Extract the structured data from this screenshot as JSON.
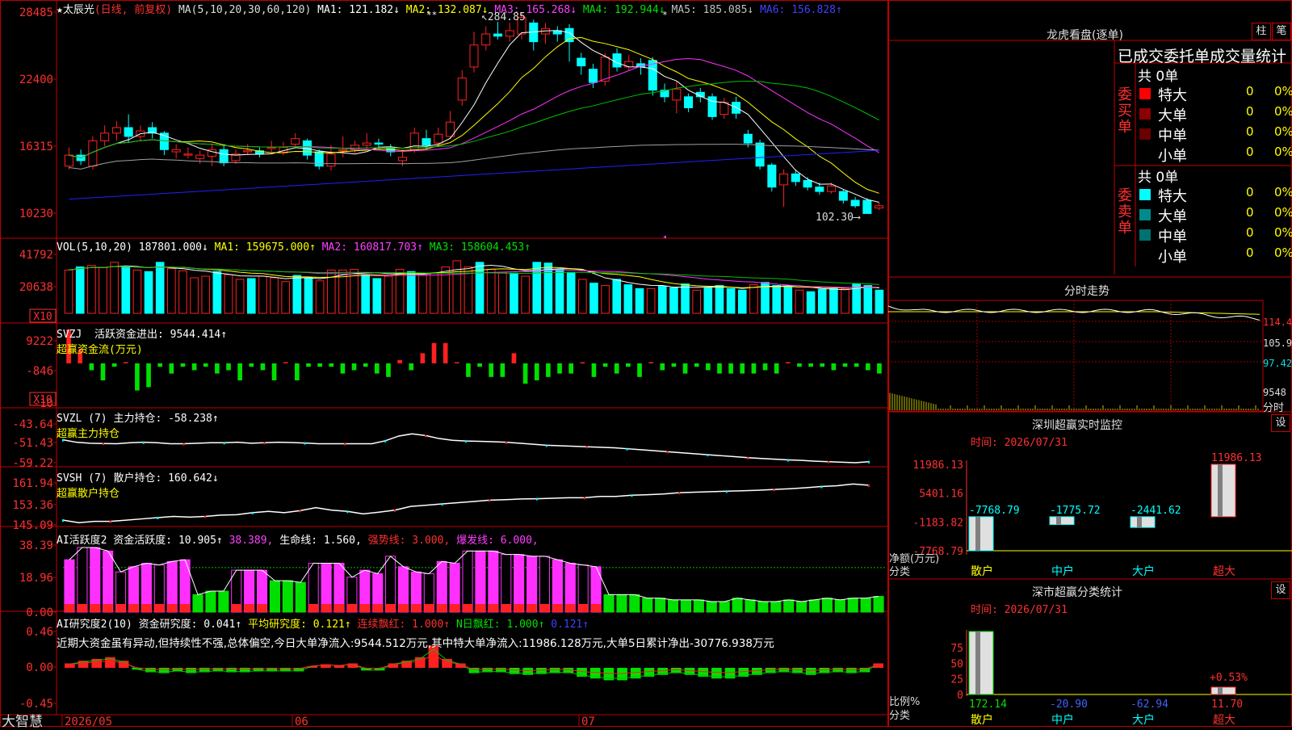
{
  "stock": {
    "name_label": "★太辰光",
    "mode_label": "(日线, 前复权)",
    "ma_header": "MA(5,10,20,30,60,120)",
    "ma1": "MA1: 121.182↓",
    "ma2": "MA2: 132.087↓",
    "ma3": "MA3: 165.268↓",
    "ma4": "MA4: 192.944↓",
    "ma5": "MA5: 185.085↓",
    "ma6": "MA6: 156.828↑",
    "high_note": "284.85",
    "low_note": "102.30"
  },
  "axes": {
    "price": [
      "28485",
      "22400",
      "16315",
      "10230"
    ],
    "vol": [
      "41792",
      "20638"
    ],
    "svzj": [
      "9222",
      "-846",
      "-10"
    ],
    "svzl": [
      "-43.64",
      "-51.43",
      "-59.22"
    ],
    "svsh": [
      "161.94",
      "153.36",
      "145.09"
    ],
    "ai1": [
      "38.39",
      "18.96",
      "0.00"
    ],
    "ai2": [
      "0.46",
      "0.00",
      "-0.45"
    ],
    "x10": "X10",
    "dates": [
      "2026/05",
      "06",
      "07"
    ]
  },
  "vol_header": {
    "a": "VOL(5,10,20) 187801.000↓",
    "b": "MA1: 159675.000↑",
    "c": "MA2: 160817.703↑",
    "d": "MA3: 158604.453↑"
  },
  "svzj_header": {
    "a": "SVZJ  活跃资金进出: 9544.414↑",
    "b": "超赢资金流(万元)"
  },
  "svzl_header": {
    "a": "SVZL (7) 主力持仓: -58.238↑",
    "b": "超赢主力持仓"
  },
  "svsh_header": {
    "a": "SVSH (7) 散户持仓: 160.642↓",
    "b": "超赢散户持仓"
  },
  "ai1_header": {
    "a": "AI活跃度2 资金活跃度: 10.905↑",
    "b": "38.389,",
    "c": "生命线: 1.560,",
    "d": "强势线: 3.000,",
    "e": "爆发线: 6.000,"
  },
  "ai2_header": {
    "a": "AI研究度2(10) 资金研究度: 0.041↑",
    "b": "平均研究度: 0.121↑",
    "c": "连续飘红: 1.000↑",
    "d": "N日飘红: 1.000↑",
    "e": "0.121↑",
    "comment": "近期大资金虽有异动,但持续性不强,总体偏空,今日大单净流入:9544.512万元,其中特大单净流入:11986.128万元,大单5日累计净出-30776.938万元"
  },
  "footer": {
    "brand": "大智慧"
  },
  "right": {
    "lhkp_title": "龙虎看盘(逐单)",
    "btn_zhu": "柱",
    "btn_bi": "笔",
    "section_title": "已成交委托单成交量统计",
    "buy_label": "委买单",
    "sell_label": "委卖单",
    "buy_total": "共 0单",
    "sell_total": "共 0单",
    "buy_rows": [
      {
        "name": "特大",
        "count": "0",
        "pct": "0%",
        "color": "#ff0000"
      },
      {
        "name": "大单",
        "count": "0",
        "pct": "0%",
        "color": "#8b0000"
      },
      {
        "name": "中单",
        "count": "0",
        "pct": "0%",
        "color": "#6b0000"
      },
      {
        "name": "小单",
        "count": "0",
        "pct": "0%",
        "color": "#000000"
      }
    ],
    "sell_rows": [
      {
        "name": "特大",
        "count": "0",
        "pct": "0%",
        "color": "#00ffff"
      },
      {
        "name": "大单",
        "count": "0",
        "pct": "0%",
        "color": "#008b8b"
      },
      {
        "name": "中单",
        "count": "0",
        "pct": "0%",
        "color": "#007070"
      },
      {
        "name": "小单",
        "count": "0",
        "pct": "0%",
        "color": "#000000"
      }
    ],
    "fszs_title": "分时走势",
    "fszs_axis": [
      "114.4",
      "105.9",
      "97.42",
      "9548",
      "分时"
    ],
    "monitor_title": "深圳超赢实时监控",
    "monitor_time": "时间: 2026/07/31",
    "monitor_btn": "设",
    "monitor_axis": [
      "11986.13",
      "5401.16",
      "-1183.82",
      "-7768.79"
    ],
    "monitor_ylabel": "净额(万元)",
    "monitor_xlabel": "分类",
    "stat_title": "深市超赢分类统计",
    "stat_time": "时间: 2026/07/31",
    "stat_btn": "设",
    "stat_axis": [
      "75",
      "50",
      "25",
      "0"
    ],
    "stat_ylabel": "比例%",
    "stat_xlabel": "分类"
  },
  "chart_data": [
    {
      "type": "candlestick",
      "title": "太辰光 日线 前复权",
      "x_range": [
        "2026/05",
        "2026/07"
      ],
      "ylim": [
        10230,
        28485
      ],
      "candles": [
        {
          "o": 14500,
          "c": 15500,
          "h": 16200,
          "l": 14200
        },
        {
          "o": 15500,
          "c": 15000,
          "h": 16000,
          "l": 14600
        },
        {
          "o": 14500,
          "c": 16800,
          "h": 17200,
          "l": 14200
        },
        {
          "o": 16800,
          "c": 17500,
          "h": 18200,
          "l": 16300
        },
        {
          "o": 17500,
          "c": 18000,
          "h": 18600,
          "l": 16800
        },
        {
          "o": 18000,
          "c": 17200,
          "h": 19200,
          "l": 16600
        },
        {
          "o": 17200,
          "c": 17700,
          "h": 18200,
          "l": 16800
        },
        {
          "o": 18000,
          "c": 17500,
          "h": 18500,
          "l": 17000
        },
        {
          "o": 17500,
          "c": 16000,
          "h": 17700,
          "l": 15500
        },
        {
          "o": 15800,
          "c": 16000,
          "h": 16500,
          "l": 15200
        },
        {
          "o": 15500,
          "c": 15600,
          "h": 16200,
          "l": 15200
        },
        {
          "o": 15200,
          "c": 15500,
          "h": 15900,
          "l": 14700
        },
        {
          "o": 15400,
          "c": 16000,
          "h": 16500,
          "l": 14500
        },
        {
          "o": 16000,
          "c": 14800,
          "h": 16500,
          "l": 14500
        },
        {
          "o": 15000,
          "c": 15600,
          "h": 16000,
          "l": 14700
        },
        {
          "o": 15800,
          "c": 15900,
          "h": 16500,
          "l": 15500
        },
        {
          "o": 15900,
          "c": 15600,
          "h": 16200,
          "l": 15300
        },
        {
          "o": 16100,
          "c": 16200,
          "h": 16800,
          "l": 15700
        },
        {
          "o": 15700,
          "c": 16200,
          "h": 16700,
          "l": 15500
        },
        {
          "o": 16500,
          "c": 17000,
          "h": 17500,
          "l": 16300
        },
        {
          "o": 16800,
          "c": 15500,
          "h": 17000,
          "l": 15100
        },
        {
          "o": 15800,
          "c": 14500,
          "h": 16000,
          "l": 14200
        },
        {
          "o": 14500,
          "c": 15600,
          "h": 16400,
          "l": 14100
        },
        {
          "o": 15900,
          "c": 16000,
          "h": 17200,
          "l": 15300
        },
        {
          "o": 16000,
          "c": 16400,
          "h": 16800,
          "l": 15700
        },
        {
          "o": 16400,
          "c": 16600,
          "h": 17500,
          "l": 16000
        },
        {
          "o": 16600,
          "c": 16500,
          "h": 17000,
          "l": 16100
        },
        {
          "o": 16100,
          "c": 15800,
          "h": 16500,
          "l": 15400
        },
        {
          "o": 15000,
          "c": 15300,
          "h": 16000,
          "l": 14500
        },
        {
          "o": 16000,
          "c": 17500,
          "h": 18000,
          "l": 15700
        },
        {
          "o": 17000,
          "c": 16400,
          "h": 17800,
          "l": 16000
        },
        {
          "o": 16600,
          "c": 17400,
          "h": 18000,
          "l": 16300
        },
        {
          "o": 17200,
          "c": 18500,
          "h": 19500,
          "l": 17000
        },
        {
          "o": 20500,
          "c": 22500,
          "h": 23200,
          "l": 20000
        },
        {
          "o": 23500,
          "c": 25500,
          "h": 26700,
          "l": 23000
        },
        {
          "o": 25500,
          "c": 26500,
          "h": 27200,
          "l": 25000
        },
        {
          "o": 26500,
          "c": 26300,
          "h": 27600,
          "l": 26000
        },
        {
          "o": 26300,
          "c": 26800,
          "h": 27500,
          "l": 25800
        },
        {
          "o": 26500,
          "c": 28000,
          "h": 28485,
          "l": 26000
        },
        {
          "o": 27500,
          "c": 25800,
          "h": 27800,
          "l": 25000
        },
        {
          "o": 26500,
          "c": 27000,
          "h": 27500,
          "l": 25600
        },
        {
          "o": 26800,
          "c": 26500,
          "h": 27200,
          "l": 25800
        },
        {
          "o": 27000,
          "c": 25800,
          "h": 27400,
          "l": 24000
        },
        {
          "o": 24300,
          "c": 23600,
          "h": 24800,
          "l": 22800
        },
        {
          "o": 23300,
          "c": 22100,
          "h": 23800,
          "l": 21600
        },
        {
          "o": 22200,
          "c": 24400,
          "h": 24800,
          "l": 21800
        },
        {
          "o": 24700,
          "c": 23500,
          "h": 25200,
          "l": 23100
        },
        {
          "o": 23500,
          "c": 24000,
          "h": 24600,
          "l": 23200
        },
        {
          "o": 23800,
          "c": 23500,
          "h": 24300,
          "l": 22800
        },
        {
          "o": 24100,
          "c": 21400,
          "h": 24400,
          "l": 20900
        },
        {
          "o": 21400,
          "c": 20800,
          "h": 22000,
          "l": 20300
        },
        {
          "o": 20500,
          "c": 21500,
          "h": 22200,
          "l": 19300
        },
        {
          "o": 20800,
          "c": 19800,
          "h": 21100,
          "l": 19400
        },
        {
          "o": 21200,
          "c": 20800,
          "h": 21600,
          "l": 20300
        },
        {
          "o": 20800,
          "c": 19000,
          "h": 21100,
          "l": 18700
        },
        {
          "o": 19200,
          "c": 20300,
          "h": 20700,
          "l": 18800
        },
        {
          "o": 20300,
          "c": 19300,
          "h": 20800,
          "l": 18800
        },
        {
          "o": 17400,
          "c": 16600,
          "h": 17800,
          "l": 16200
        },
        {
          "o": 16600,
          "c": 14500,
          "h": 16900,
          "l": 14200
        },
        {
          "o": 14600,
          "c": 12600,
          "h": 14800,
          "l": 12200
        },
        {
          "o": 12800,
          "c": 13800,
          "h": 14200,
          "l": 10800
        },
        {
          "o": 13800,
          "c": 13100,
          "h": 14200,
          "l": 12700
        },
        {
          "o": 13200,
          "c": 12600,
          "h": 13500,
          "l": 12300
        },
        {
          "o": 12600,
          "c": 12200,
          "h": 13000,
          "l": 11900
        },
        {
          "o": 12200,
          "c": 12700,
          "h": 13000,
          "l": 12000
        },
        {
          "o": 12200,
          "c": 11400,
          "h": 12400,
          "l": 11100
        },
        {
          "o": 11400,
          "c": 10900,
          "h": 11700,
          "l": 10700
        },
        {
          "o": 11400,
          "c": 10200,
          "h": 11600,
          "l": 10230
        },
        {
          "o": 10700,
          "c": 10900,
          "h": 11200,
          "l": 10500
        }
      ]
    },
    {
      "type": "bar",
      "title": "VOL",
      "ylim": [
        0,
        41792
      ],
      "values": [
        28000,
        30000,
        31000,
        29500,
        33000,
        30000,
        28000,
        27000,
        33000,
        29000,
        27500,
        23000,
        24000,
        27000,
        25000,
        22000,
        22500,
        24000,
        23000,
        20500,
        24500,
        23000,
        21000,
        28000,
        28000,
        28500,
        25000,
        22500,
        24000,
        28500,
        27000,
        24500,
        26000,
        30000,
        34000,
        30000,
        33000,
        28500,
        26500,
        26000,
        24000,
        33000,
        32500,
        28500,
        26500,
        22000,
        19500,
        18000,
        22000,
        18500,
        16000,
        16000,
        17500,
        16500,
        19000,
        15000,
        16500,
        18000,
        16000,
        15000,
        18500,
        20000,
        18000,
        17500,
        15000,
        14000,
        15500,
        16000,
        16000,
        19000,
        18000,
        15000
      ]
    },
    {
      "type": "bar",
      "title": "SVZJ 活跃资金进出",
      "ylim": [
        -10,
        9222
      ],
      "values": [
        10,
        4,
        -2,
        -5,
        -1,
        0,
        -8,
        -7,
        -1,
        -3,
        -1,
        -2,
        -1,
        -3,
        -2,
        -5,
        -1,
        -2,
        -5,
        0,
        -5,
        -1,
        -1,
        -1,
        -3,
        -2,
        -1,
        -3,
        -4,
        1,
        -2,
        3,
        6,
        6,
        0,
        -4,
        -1,
        -4,
        -4,
        3,
        -6,
        -5,
        -4,
        -3,
        -3,
        0,
        -4,
        -1,
        -3,
        -1,
        -4,
        0,
        -2,
        -1,
        -3,
        -1,
        -2,
        -3,
        -3,
        -3,
        -3,
        -2,
        -3,
        0,
        -1,
        -1,
        -1,
        -2,
        -1,
        -1,
        -2,
        -3
      ]
    },
    {
      "type": "line",
      "title": "SVZL 主力持仓",
      "ylim": [
        -59.22,
        -43.64
      ],
      "values": [
        -50.0,
        -51.0,
        -51.4,
        -51.5,
        -51.6,
        -51.2,
        -51.0,
        -51.2,
        -51.6,
        -51.6,
        -51.4,
        -51.2,
        -51.2,
        -51.0,
        -51.4,
        -51.2,
        -51.0,
        -51.1,
        -51.3,
        -51.6,
        -51.6,
        -51.6,
        -51.6,
        -51.6,
        -50.4,
        -48.5,
        -47.6,
        -48.3,
        -49.5,
        -50.2,
        -50.5,
        -50.6,
        -50.8,
        -51.0,
        -51.4,
        -51.8,
        -52.2,
        -52.4,
        -52.6,
        -52.8,
        -53.0,
        -53.2,
        -53.6,
        -54.0,
        -54.4,
        -54.8,
        -55.2,
        -55.6,
        -56.0,
        -56.4,
        -56.8,
        -57.2,
        -57.5,
        -57.8,
        -58.1,
        -58.3,
        -58.6,
        -58.8,
        -59.0,
        -59.22,
        -58.8
      ]
    },
    {
      "type": "line",
      "title": "SVSH 散户持仓",
      "ylim": [
        145.09,
        161.94
      ],
      "values": [
        147.0,
        146.0,
        146.5,
        146.5,
        147.0,
        147.5,
        148.0,
        148.5,
        148.2,
        148.5,
        149.0,
        149.2,
        150.0,
        150.5,
        150.0,
        150.8,
        152.0,
        151.0,
        150.5,
        149.5,
        150.2,
        151.0,
        152.5,
        153.0,
        153.5,
        154.0,
        154.5,
        155.0,
        155.2,
        155.5,
        155.6,
        155.8,
        156.0,
        156.0,
        156.5,
        156.5,
        157.0,
        157.2,
        157.5,
        158.0,
        158.2,
        158.4,
        158.6,
        158.8,
        159.0,
        159.3,
        159.6,
        160.0,
        160.5,
        160.8,
        161.5,
        161.0
      ]
    },
    {
      "type": "bar",
      "title": "AI活跃度2 资金活跃度",
      "ylim": [
        0,
        38.39
      ],
      "values": [
        30,
        37,
        37,
        35,
        23,
        26,
        28,
        27,
        29,
        30,
        10,
        12,
        12,
        24,
        24,
        24,
        18,
        18,
        17,
        28,
        28,
        28,
        20,
        24,
        22,
        32,
        26,
        23,
        22,
        29,
        28,
        35,
        35,
        35,
        33,
        33,
        32,
        32,
        30,
        28,
        27,
        26,
        10,
        10,
        10,
        8,
        8,
        7,
        7,
        7,
        6,
        6,
        8,
        7,
        6,
        6,
        7,
        6,
        7,
        8,
        7,
        8,
        8,
        9
      ]
    },
    {
      "type": "bar",
      "title": "AI研究度2 资金研究度",
      "ylim": [
        -0.45,
        0.46
      ],
      "values": [
        0.05,
        0.08,
        0.1,
        0.12,
        0.08,
        -0.02,
        -0.05,
        -0.06,
        -0.04,
        -0.06,
        -0.05,
        -0.04,
        -0.05,
        -0.05,
        -0.04,
        -0.04,
        -0.04,
        -0.04,
        0.02,
        0.04,
        0.03,
        0.05,
        -0.03,
        -0.03,
        0.05,
        0.08,
        0.12,
        0.25,
        0.1,
        0.05,
        -0.06,
        -0.05,
        -0.05,
        -0.07,
        -0.08,
        -0.07,
        -0.06,
        -0.06,
        -0.1,
        -0.12,
        -0.14,
        -0.14,
        -0.12,
        -0.1,
        -0.08,
        -0.06,
        -0.08,
        -0.1,
        -0.12,
        -0.12,
        -0.1,
        -0.08,
        -0.06,
        -0.05,
        -0.06,
        -0.08,
        -0.06,
        -0.05,
        -0.06,
        -0.05,
        0.05
      ]
    },
    {
      "type": "bar",
      "title": "深圳超赢实时监控",
      "categories": [
        "散户",
        "中户",
        "大户",
        "超大"
      ],
      "values": [
        -7768.79,
        -1775.72,
        -2441.62,
        11986.13
      ],
      "ylim": [
        -7768.79,
        11986.13
      ]
    },
    {
      "type": "bar",
      "title": "深市超赢分类统计",
      "categories": [
        "散户",
        "中户",
        "大户",
        "超大"
      ],
      "values": [
        172.14,
        -20.9,
        -62.94,
        11.7
      ],
      "pct_label": "+0.53%",
      "ylim": [
        0,
        75
      ]
    }
  ]
}
